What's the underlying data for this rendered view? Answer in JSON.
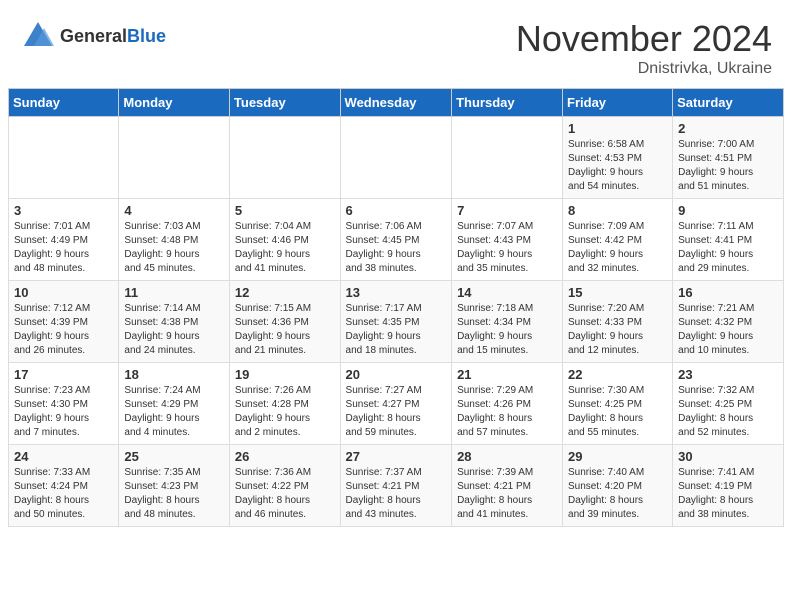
{
  "header": {
    "logo_general": "General",
    "logo_blue": "Blue",
    "title": "November 2024",
    "subtitle": "Dnistrivka, Ukraine"
  },
  "calendar": {
    "headers": [
      "Sunday",
      "Monday",
      "Tuesday",
      "Wednesday",
      "Thursday",
      "Friday",
      "Saturday"
    ],
    "weeks": [
      [
        {
          "day": "",
          "info": ""
        },
        {
          "day": "",
          "info": ""
        },
        {
          "day": "",
          "info": ""
        },
        {
          "day": "",
          "info": ""
        },
        {
          "day": "",
          "info": ""
        },
        {
          "day": "1",
          "info": "Sunrise: 6:58 AM\nSunset: 4:53 PM\nDaylight: 9 hours\nand 54 minutes."
        },
        {
          "day": "2",
          "info": "Sunrise: 7:00 AM\nSunset: 4:51 PM\nDaylight: 9 hours\nand 51 minutes."
        }
      ],
      [
        {
          "day": "3",
          "info": "Sunrise: 7:01 AM\nSunset: 4:49 PM\nDaylight: 9 hours\nand 48 minutes."
        },
        {
          "day": "4",
          "info": "Sunrise: 7:03 AM\nSunset: 4:48 PM\nDaylight: 9 hours\nand 45 minutes."
        },
        {
          "day": "5",
          "info": "Sunrise: 7:04 AM\nSunset: 4:46 PM\nDaylight: 9 hours\nand 41 minutes."
        },
        {
          "day": "6",
          "info": "Sunrise: 7:06 AM\nSunset: 4:45 PM\nDaylight: 9 hours\nand 38 minutes."
        },
        {
          "day": "7",
          "info": "Sunrise: 7:07 AM\nSunset: 4:43 PM\nDaylight: 9 hours\nand 35 minutes."
        },
        {
          "day": "8",
          "info": "Sunrise: 7:09 AM\nSunset: 4:42 PM\nDaylight: 9 hours\nand 32 minutes."
        },
        {
          "day": "9",
          "info": "Sunrise: 7:11 AM\nSunset: 4:41 PM\nDaylight: 9 hours\nand 29 minutes."
        }
      ],
      [
        {
          "day": "10",
          "info": "Sunrise: 7:12 AM\nSunset: 4:39 PM\nDaylight: 9 hours\nand 26 minutes."
        },
        {
          "day": "11",
          "info": "Sunrise: 7:14 AM\nSunset: 4:38 PM\nDaylight: 9 hours\nand 24 minutes."
        },
        {
          "day": "12",
          "info": "Sunrise: 7:15 AM\nSunset: 4:36 PM\nDaylight: 9 hours\nand 21 minutes."
        },
        {
          "day": "13",
          "info": "Sunrise: 7:17 AM\nSunset: 4:35 PM\nDaylight: 9 hours\nand 18 minutes."
        },
        {
          "day": "14",
          "info": "Sunrise: 7:18 AM\nSunset: 4:34 PM\nDaylight: 9 hours\nand 15 minutes."
        },
        {
          "day": "15",
          "info": "Sunrise: 7:20 AM\nSunset: 4:33 PM\nDaylight: 9 hours\nand 12 minutes."
        },
        {
          "day": "16",
          "info": "Sunrise: 7:21 AM\nSunset: 4:32 PM\nDaylight: 9 hours\nand 10 minutes."
        }
      ],
      [
        {
          "day": "17",
          "info": "Sunrise: 7:23 AM\nSunset: 4:30 PM\nDaylight: 9 hours\nand 7 minutes."
        },
        {
          "day": "18",
          "info": "Sunrise: 7:24 AM\nSunset: 4:29 PM\nDaylight: 9 hours\nand 4 minutes."
        },
        {
          "day": "19",
          "info": "Sunrise: 7:26 AM\nSunset: 4:28 PM\nDaylight: 9 hours\nand 2 minutes."
        },
        {
          "day": "20",
          "info": "Sunrise: 7:27 AM\nSunset: 4:27 PM\nDaylight: 8 hours\nand 59 minutes."
        },
        {
          "day": "21",
          "info": "Sunrise: 7:29 AM\nSunset: 4:26 PM\nDaylight: 8 hours\nand 57 minutes."
        },
        {
          "day": "22",
          "info": "Sunrise: 7:30 AM\nSunset: 4:25 PM\nDaylight: 8 hours\nand 55 minutes."
        },
        {
          "day": "23",
          "info": "Sunrise: 7:32 AM\nSunset: 4:25 PM\nDaylight: 8 hours\nand 52 minutes."
        }
      ],
      [
        {
          "day": "24",
          "info": "Sunrise: 7:33 AM\nSunset: 4:24 PM\nDaylight: 8 hours\nand 50 minutes."
        },
        {
          "day": "25",
          "info": "Sunrise: 7:35 AM\nSunset: 4:23 PM\nDaylight: 8 hours\nand 48 minutes."
        },
        {
          "day": "26",
          "info": "Sunrise: 7:36 AM\nSunset: 4:22 PM\nDaylight: 8 hours\nand 46 minutes."
        },
        {
          "day": "27",
          "info": "Sunrise: 7:37 AM\nSunset: 4:21 PM\nDaylight: 8 hours\nand 43 minutes."
        },
        {
          "day": "28",
          "info": "Sunrise: 7:39 AM\nSunset: 4:21 PM\nDaylight: 8 hours\nand 41 minutes."
        },
        {
          "day": "29",
          "info": "Sunrise: 7:40 AM\nSunset: 4:20 PM\nDaylight: 8 hours\nand 39 minutes."
        },
        {
          "day": "30",
          "info": "Sunrise: 7:41 AM\nSunset: 4:19 PM\nDaylight: 8 hours\nand 38 minutes."
        }
      ]
    ]
  }
}
